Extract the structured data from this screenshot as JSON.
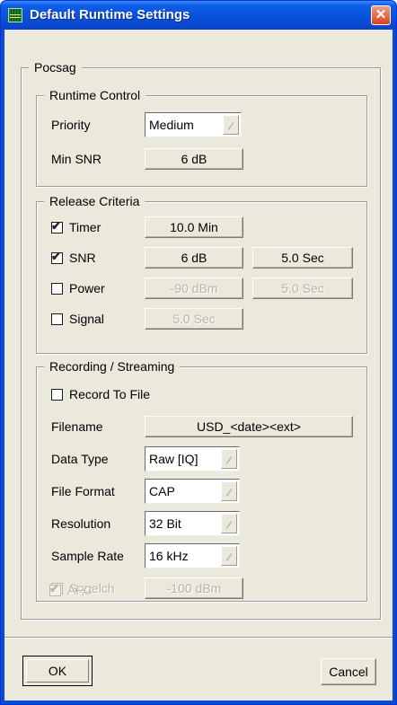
{
  "window": {
    "title": "Default Runtime Settings",
    "close_glyph": "✕",
    "icon": "spectrum-app-icon"
  },
  "pocsag": {
    "legend": "Pocsag",
    "runtime_control": {
      "legend": "Runtime Control",
      "priority_label": "Priority",
      "priority_value": "Medium",
      "min_snr_label": "Min SNR",
      "min_snr_value": "6 dB"
    },
    "release_criteria": {
      "legend": "Release Criteria",
      "timer": {
        "label": "Timer",
        "checked": true,
        "value": "10.0 Min"
      },
      "snr": {
        "label": "SNR",
        "checked": true,
        "value": "6 dB",
        "time": "5.0 Sec"
      },
      "power": {
        "label": "Power",
        "checked": false,
        "value": "-90 dBm",
        "time": "5.0 Sec"
      },
      "signal": {
        "label": "Signal",
        "checked": false,
        "time": "5.0 Sec"
      }
    },
    "recording": {
      "legend": "Recording / Streaming",
      "record_to_file": {
        "label": "Record To File",
        "checked": false
      },
      "filename_label": "Filename",
      "filename_value": "USD_<date><ext>",
      "data_type_label": "Data Type",
      "data_type_value": "Raw [IQ]",
      "file_format_label": "File Format",
      "file_format_value": "CAP",
      "resolution_label": "Resolution",
      "resolution_value": "32 Bit",
      "sample_rate_label": "Sample Rate",
      "sample_rate_value": "16 kHz",
      "squelch": {
        "label": "Squelch",
        "checked": false,
        "value": "-100 dBm"
      },
      "afc": {
        "label": "AFC",
        "checked": true
      }
    }
  },
  "buttons": {
    "ok": "OK",
    "cancel": "Cancel"
  },
  "check_glyph": "✔",
  "colors": {
    "titlebar": "#0a4fd8",
    "client": "#ebe9dc",
    "close": "#d9421f"
  }
}
